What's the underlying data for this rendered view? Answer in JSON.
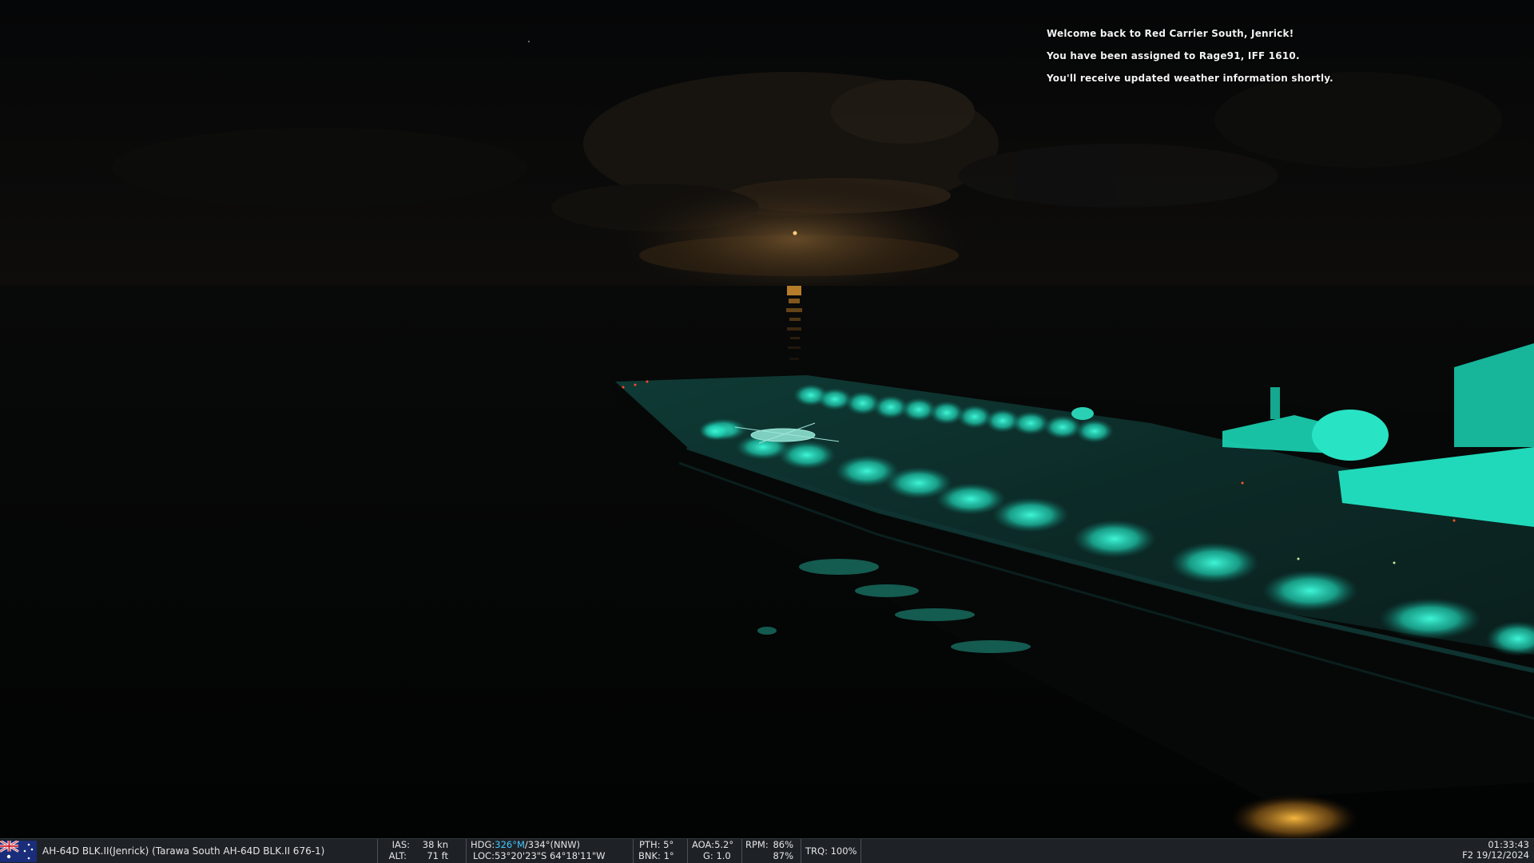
{
  "chat": {
    "messages": [
      "Welcome back to Red Carrier South, Jenrick!",
      "You have been assigned to Rage91, IFF 1610.",
      "You'll receive updated weather information shortly."
    ]
  },
  "statusbar": {
    "flag_icon": "australia-flag-icon",
    "unit_label": "AH-64D BLK.II(Jenrick) (Tarawa South AH-64D BLK.II 676-1)",
    "ias_label": "IAS:",
    "ias_value": "38 kn",
    "alt_label": "ALT:",
    "alt_value": "71 ft",
    "hdg_label": "HDG:",
    "hdg_mag": "326°M",
    "hdg_true": "/334°(NNW)",
    "loc_label": "LOC:",
    "loc_value": "53°20'23\"S 64°18'11\"W",
    "pth_label": "PTH:",
    "pth_value": "5°",
    "bnk_label": "BNK:",
    "bnk_value": "1°",
    "aoa_label": "AOA:",
    "aoa_value": "5.2°",
    "g_label": "G:",
    "g_value": "1.0",
    "rpm_label": "RPM:",
    "rpm_value_1": "86%",
    "rpm_value_2": "87%",
    "trq_label": "TRQ:",
    "trq_value": "100%",
    "time": "01:33:43",
    "date": "F2 19/12/2024"
  },
  "colors": {
    "deck_light": "#22e8c8",
    "moon_glow": "#d98a2a",
    "highlight": "#46c7ff",
    "bar_bg": "#1e2227"
  }
}
